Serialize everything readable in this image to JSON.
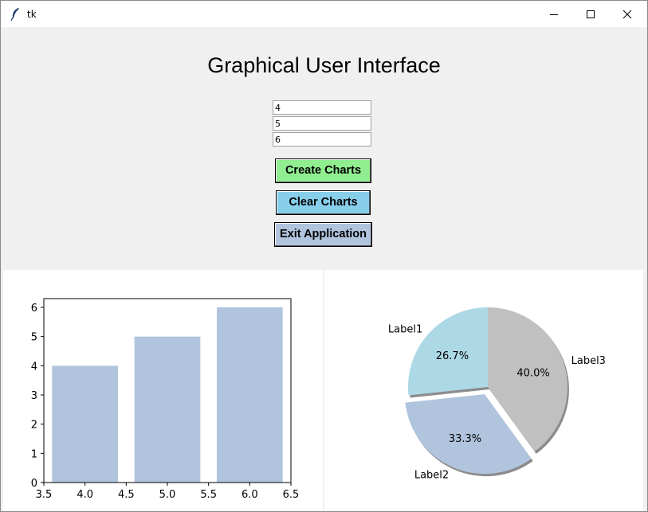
{
  "window": {
    "title": "tk"
  },
  "heading": "Graphical User Interface",
  "inputs": [
    "4",
    "5",
    "6"
  ],
  "buttons": {
    "create": {
      "label": "Create Charts",
      "color": "#90ee90"
    },
    "clear": {
      "label": "Clear Charts",
      "color": "#87ceeb"
    },
    "exit": {
      "label": "Exit Application",
      "color": "#b0c4de"
    }
  },
  "chart_data": [
    {
      "type": "bar",
      "x": [
        4,
        5,
        6
      ],
      "values": [
        4,
        5,
        6
      ],
      "bar_width": 0.8,
      "color": "#b0c4de",
      "xlim": [
        3.5,
        6.5
      ],
      "ylim": [
        0,
        6.3
      ],
      "xticks": [
        "3.5",
        "4.0",
        "4.5",
        "5.0",
        "5.5",
        "6.0",
        "6.5"
      ],
      "yticks": [
        "0",
        "1",
        "2",
        "3",
        "4",
        "5",
        "6"
      ],
      "title": "",
      "xlabel": "",
      "ylabel": ""
    },
    {
      "type": "pie",
      "labels": [
        "Label1",
        "Label2",
        "Label3"
      ],
      "values": [
        4,
        5,
        6
      ],
      "percent_labels": [
        "26.7%",
        "33.3%",
        "40.0%"
      ],
      "colors": [
        "#add8e6",
        "#b0c4de",
        "#c0c0c0"
      ],
      "explode": [
        0,
        0.1,
        0
      ],
      "shadow": true,
      "start_angle": 90
    }
  ]
}
